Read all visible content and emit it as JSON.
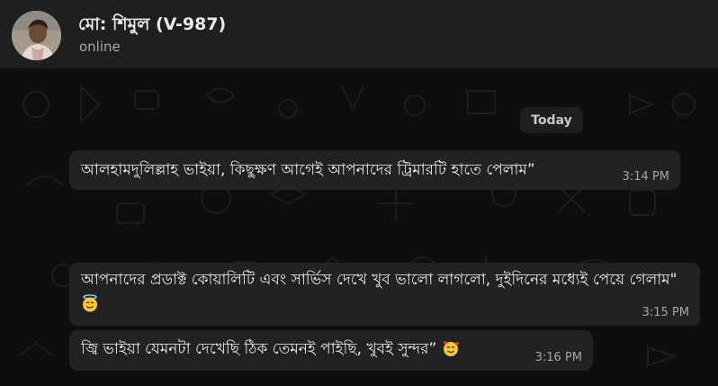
{
  "header": {
    "contact_name": "মো: শিমুল (V-987)",
    "status": "online",
    "avatar_icon": "person-photo-avatar"
  },
  "chat": {
    "date_separator": "Today",
    "messages": [
      {
        "text": "আলহামদুলিল্লাহ ভাইয়া, কিছুক্ষণ আগেই আপনাদের ট্রিমারটি হাতে পেলাম”",
        "time": "3:14 PM"
      },
      {
        "text": "আপনাদের প্রডাক্ট কোয়ালিটি এবং সার্ভিস দেখে খুব ভালো লাগলো, দুইদিনের মধ্যেই পেয়ে গেলাম\"",
        "emoji": "smiling-face-with-halo-icon",
        "time": "3:15 PM"
      },
      {
        "text": "জ্বি ভাইয়া যেমনটা দেখেছি ঠিক তেমনই পাইছি, খুবই সুন্দর”",
        "emoji": "smiling-face-with-hearts-icon",
        "time": "3:16 PM"
      }
    ]
  },
  "colors": {
    "background": "#0b0b0b",
    "header": "#1f1f1f",
    "bubble_incoming": "#222222",
    "text": "#e9e9e9",
    "muted": "#a6a6a6"
  }
}
